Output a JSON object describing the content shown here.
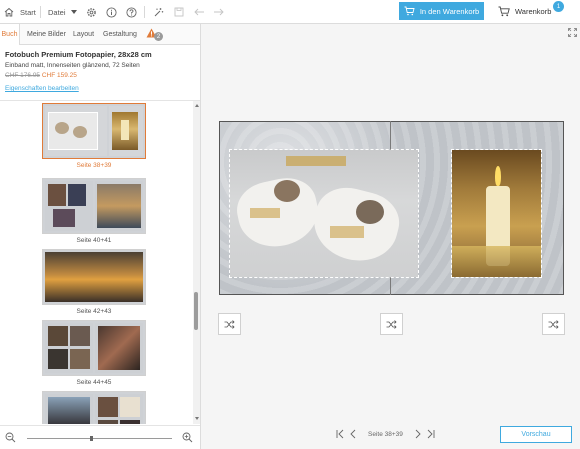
{
  "toolbar": {
    "start_label": "Start",
    "file_label": "Datei",
    "add_to_cart_label": "In den Warenkorb",
    "cart_label": "Warenkorb",
    "cart_count": "1",
    "accent_color": "#3fa9df",
    "icons": [
      "home-icon",
      "chevron-down-icon",
      "gear-icon",
      "info-icon",
      "help-icon",
      "magic-wand-icon",
      "save-icon",
      "undo-icon",
      "redo-icon",
      "cart-icon"
    ]
  },
  "tabs": [
    {
      "label": "Buch",
      "active": true
    },
    {
      "label": "Meine Bilder",
      "active": false
    },
    {
      "label": "Layout",
      "active": false
    },
    {
      "label": "Gestaltung",
      "active": false
    }
  ],
  "warnings": {
    "count": "2"
  },
  "product": {
    "title": "Fotobuch Premium Fotopapier, 28x28 cm",
    "description": "Einband matt, Innenseiten glänzend, 72 Seiten",
    "price_old": "CHF 176.95",
    "price_new": "CHF 159.25",
    "edit_link": "Eigenschaften bearbeiten"
  },
  "thumbnails": [
    {
      "label": "Seite 38+39",
      "selected": true
    },
    {
      "label": "Seite 40+41",
      "selected": false
    },
    {
      "label": "Seite 42+43",
      "selected": false
    },
    {
      "label": "Seite 44+45",
      "selected": false
    },
    {
      "label": "",
      "selected": false
    }
  ],
  "pager": {
    "label": "Seite 38+39"
  },
  "preview_label": "Vorschau",
  "accent_orange": "#e07b39"
}
